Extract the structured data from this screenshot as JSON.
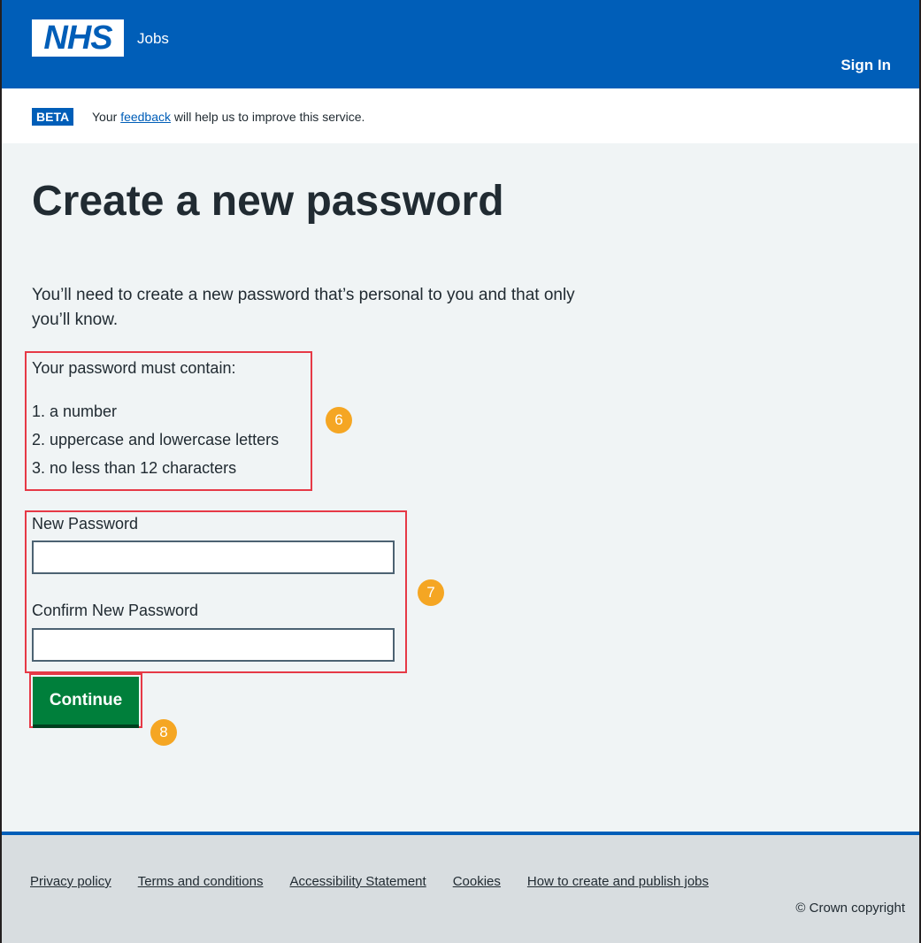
{
  "header": {
    "logo_text": "NHS",
    "service_name": "Jobs",
    "sign_in_label": "Sign In"
  },
  "beta_banner": {
    "tag": "BETA",
    "text_before": "Your ",
    "link_text": "feedback",
    "text_after": " will help us to improve this service."
  },
  "main": {
    "title": "Create a new password",
    "intro": "You’ll need to create a new password that’s personal to you and that only you’ll know.",
    "requirements_title": "Your password must contain:",
    "requirements": [
      "1. a number",
      "2. uppercase and lowercase letters",
      "3. no less than 12 characters"
    ],
    "new_password_label": "New Password",
    "new_password_value": "",
    "confirm_password_label": "Confirm New Password",
    "confirm_password_value": "",
    "continue_label": "Continue"
  },
  "annotations": {
    "badge_6": "6",
    "badge_7": "7",
    "badge_8": "8",
    "badge_color": "#f5a623",
    "highlight_color": "#e63946"
  },
  "footer": {
    "links": [
      "Privacy policy",
      "Terms and conditions",
      "Accessibility Statement",
      "Cookies",
      "How to create and publish jobs"
    ],
    "copyright": "© Crown copyright"
  },
  "colors": {
    "brand_blue": "#005eb8",
    "button_green": "#007f3b",
    "page_background": "#f0f4f5",
    "footer_background": "#d8dde0"
  }
}
